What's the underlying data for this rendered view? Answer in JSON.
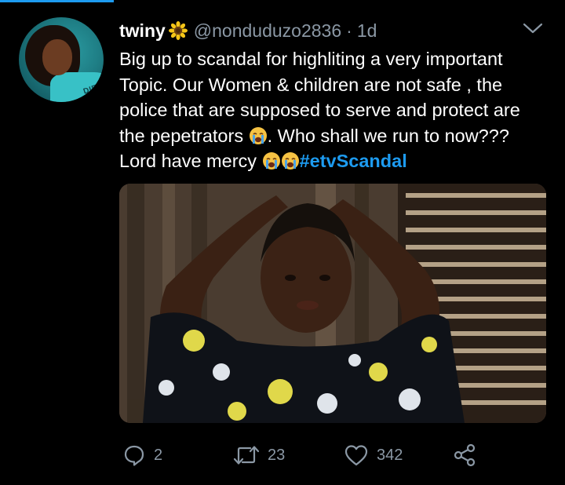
{
  "tweet": {
    "author_name": "twiny",
    "handle": "@nonduduzo2836",
    "separator": "·",
    "timestamp": "1d",
    "text_lines": [
      "Big up to scandal for highliting a very important",
      "Topic. Our Women & children are not safe , the",
      "police that are supposed to serve and protect are",
      "the pepetrators",
      ". Who shall we run to now???",
      "Lord have mercy "
    ],
    "hashtag": "#etvScandal",
    "avatar_text": "DIET",
    "icons": {
      "name_badge": "sunflower-icon",
      "emoji": "loudly-crying-face-emoji",
      "menu": "chevron-down-icon"
    }
  },
  "actions": {
    "reply_count": "2",
    "retweet_count": "23",
    "like_count": "342",
    "icons": [
      "reply-icon",
      "retweet-icon",
      "like-icon",
      "share-icon"
    ]
  },
  "colors": {
    "background": "#000000",
    "text": "#ffffff",
    "secondary": "#8b98a5",
    "accent": "#1d9bf0"
  }
}
